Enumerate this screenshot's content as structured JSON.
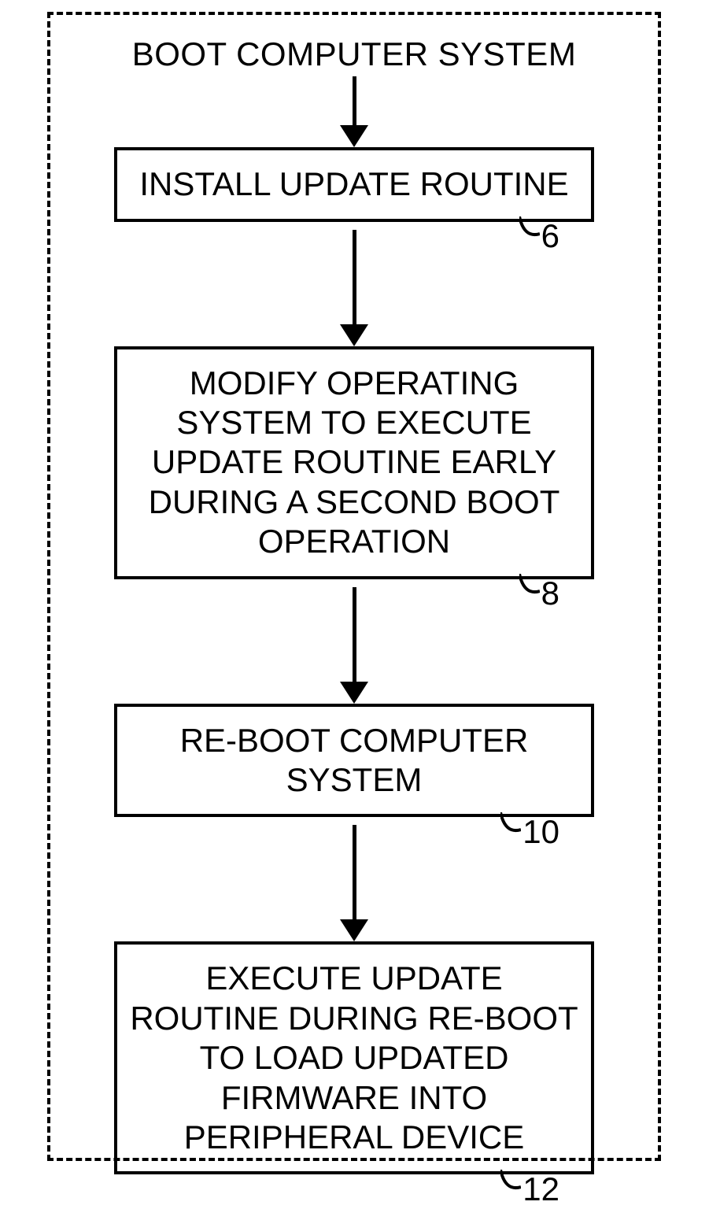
{
  "flowchart": {
    "start_label": "BOOT COMPUTER SYSTEM",
    "nodes": [
      {
        "text": "INSTALL UPDATE ROUTINE",
        "ref": "6"
      },
      {
        "text": "MODIFY OPERATING SYSTEM TO EXECUTE UPDATE ROUTINE EARLY DURING A SECOND BOOT OPERATION",
        "ref": "8"
      },
      {
        "text": "RE-BOOT COMPUTER SYSTEM",
        "ref": "10"
      },
      {
        "text": "EXECUTE UPDATE ROUTINE DURING RE-BOOT TO LOAD UPDATED FIRMWARE INTO PERIPHERAL DEVICE",
        "ref": "12"
      }
    ]
  }
}
